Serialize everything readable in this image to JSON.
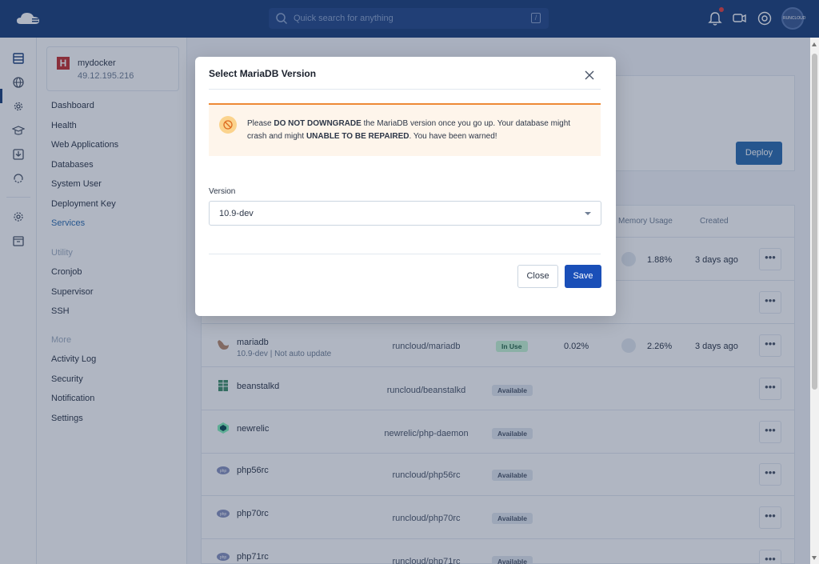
{
  "topbar": {
    "search_placeholder": "Quick search for anything",
    "search_shortcut": "/",
    "avatar_text": "RUNCLOUD"
  },
  "server": {
    "name": "mydocker",
    "ip": "49.12.195.216",
    "logo_letter": "H"
  },
  "nav": {
    "items": [
      "Dashboard",
      "Health",
      "Web Applications",
      "Databases",
      "System User",
      "Deployment Key",
      "Services"
    ],
    "utility_heading": "Utility",
    "utility_items": [
      "Cronjob",
      "Supervisor",
      "SSH"
    ],
    "more_heading": "More",
    "more_items": [
      "Activity Log",
      "Security",
      "Notification",
      "Settings"
    ]
  },
  "main": {
    "deploy_label": "Deploy",
    "columns": {
      "memory": "Memory Usage",
      "created": "Created"
    },
    "rows": [
      {
        "name": "",
        "sub": "",
        "image": "",
        "status": "",
        "cpu": "",
        "memory": "1.88%",
        "created": "3 days ago"
      },
      {
        "name": "",
        "sub": "",
        "image": "",
        "status": "",
        "cpu": "",
        "memory": "",
        "created": ""
      },
      {
        "name": "mariadb",
        "sub": "10.9-dev | Not auto update",
        "image": "runcloud/mariadb",
        "status": "In Use",
        "cpu": "0.02%",
        "memory": "2.26%",
        "created": "3 days ago"
      },
      {
        "name": "beanstalkd",
        "sub": "",
        "image": "runcloud/beanstalkd",
        "status": "Available",
        "cpu": "",
        "memory": "",
        "created": ""
      },
      {
        "name": "newrelic",
        "sub": "",
        "image": "newrelic/php-daemon",
        "status": "Available",
        "cpu": "",
        "memory": "",
        "created": ""
      },
      {
        "name": "php56rc",
        "sub": "",
        "image": "runcloud/php56rc",
        "status": "Available",
        "cpu": "",
        "memory": "",
        "created": ""
      },
      {
        "name": "php70rc",
        "sub": "",
        "image": "runcloud/php70rc",
        "status": "Available",
        "cpu": "",
        "memory": "",
        "created": ""
      },
      {
        "name": "php71rc",
        "sub": "",
        "image": "runcloud/php71rc",
        "status": "Available",
        "cpu": "",
        "memory": "",
        "created": ""
      }
    ],
    "more_glyph": "•••"
  },
  "modal": {
    "title": "Select MariaDB Version",
    "alert_pre": "Please ",
    "alert_bold1": "DO NOT DOWNGRADE",
    "alert_mid": " the MariaDB version once you go up. Your database might crash and might ",
    "alert_bold2": "UNABLE TO BE REPAIRED",
    "alert_post": ". You have been warned!",
    "version_label": "Version",
    "version_value": "10.9-dev",
    "close_label": "Close",
    "save_label": "Save"
  },
  "colors": {
    "brand": "#1b3f7b",
    "primary_button": "#1a4fb8",
    "warning": "#ed8936",
    "in_use_badge": "#c6f6d5"
  }
}
